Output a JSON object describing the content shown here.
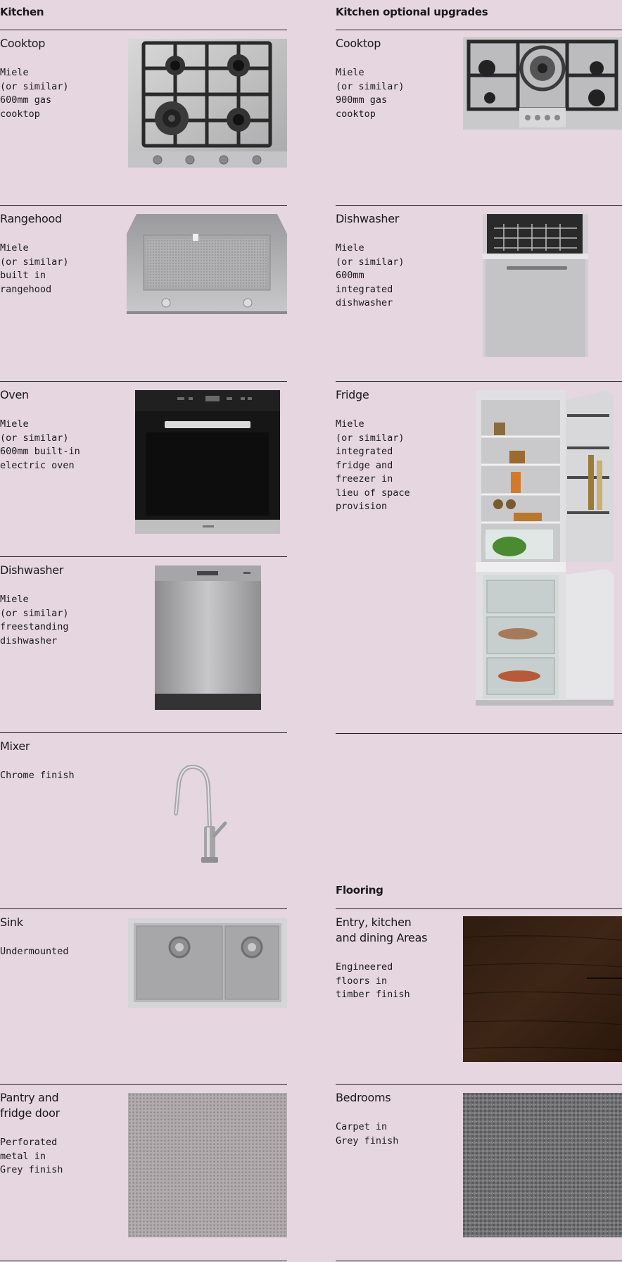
{
  "kitchen": {
    "title": "Kitchen",
    "items": [
      {
        "name": "Cooktop",
        "desc": "Miele\n(or similar)\n600mm gas\ncooktop"
      },
      {
        "name": "Rangehood",
        "desc": "Miele\n(or similar)\nbuilt in\nrangehood"
      },
      {
        "name": "Oven",
        "desc": "Miele\n(or similar)\n600mm built-in\nelectric oven"
      },
      {
        "name": "Dishwasher",
        "desc": "Miele\n(or similar)\nfreestanding\ndishwasher"
      },
      {
        "name": "Mixer",
        "desc": "Chrome finish"
      },
      {
        "name": "Sink",
        "desc": "Undermounted"
      },
      {
        "name": "Pantry and\nfridge door",
        "desc": "Perforated\nmetal in\nGrey finish"
      }
    ]
  },
  "upgrades": {
    "title": "Kitchen optional upgrades",
    "items": [
      {
        "name": "Cooktop",
        "desc": "Miele\n(or similar)\n900mm gas\ncooktop"
      },
      {
        "name": "Dishwasher",
        "desc": "Miele\n(or similar)\n600mm\nintegrated\ndishwasher"
      },
      {
        "name": "Fridge",
        "desc": "Miele\n(or similar)\nintegrated\nfridge and\nfreezer in\nlieu of space\nprovision"
      }
    ]
  },
  "flooring": {
    "title": "Flooring",
    "items": [
      {
        "name": "Entry, kitchen\nand dining Areas",
        "desc": "Engineered\nfloors in\ntimber finish"
      },
      {
        "name": "Bedrooms",
        "desc": "Carpet in\nGrey finish"
      }
    ]
  }
}
